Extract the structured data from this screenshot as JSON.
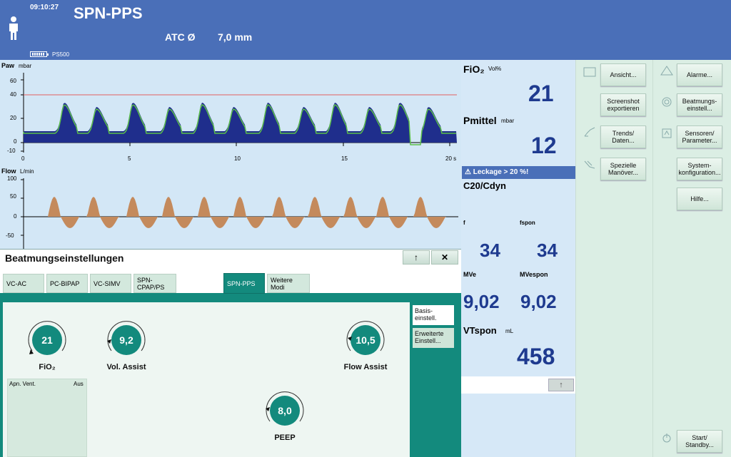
{
  "header": {
    "time": "09:10:27",
    "mode": "SPN-PPS",
    "atc_label": "ATC Ø",
    "atc_value": "7,0 mm",
    "device": "PS500",
    "bg_color": "#4a6fb8"
  },
  "waves": {
    "paw": {
      "title": "Paw",
      "unit": "mbar",
      "y_ticks": [
        "60",
        "40",
        "20",
        "0",
        "-10"
      ]
    },
    "flow": {
      "title": "Flow",
      "unit": "L/min",
      "y_ticks": [
        "100",
        "50",
        "0",
        "-50"
      ]
    },
    "x_ticks": [
      "0",
      "5",
      "10",
      "15",
      "20 s"
    ]
  },
  "measurements": {
    "fio2": {
      "label": "FiO₂",
      "unit": "Vol%",
      "value": "21"
    },
    "pmittel": {
      "label": "Pmittel",
      "unit": "mbar",
      "value": "12"
    },
    "leak_alert": "⚠ Leckage > 20 %!",
    "c20": {
      "label": "C20/Cdyn"
    },
    "f": {
      "label": "f",
      "value": "34"
    },
    "fspon": {
      "label": "fspon",
      "value": "34"
    },
    "mve": {
      "label": "MVe",
      "value": "9,02"
    },
    "mvespon": {
      "label": "MVespon",
      "value": "9,02"
    },
    "vtspon": {
      "label": "VTspon",
      "unit": "mL",
      "value": "458"
    },
    "up_arrow": "↑"
  },
  "right_panel": {
    "col1": [
      {
        "label": "Ansicht..."
      },
      {
        "label": "Screenshot exportieren"
      },
      {
        "label": "Trends/ Daten..."
      },
      {
        "label": "Spezielle Manöver..."
      }
    ],
    "col2": [
      {
        "label": "Alarme..."
      },
      {
        "label": "Beatmungs-einstell..."
      },
      {
        "label": "Sensoren/ Parameter..."
      },
      {
        "label": "System-konfiguration..."
      },
      {
        "label": "Hilfe..."
      },
      {
        "label": "Start/ Standby..."
      }
    ]
  },
  "dialog": {
    "title": "Beatmungseinstellungen",
    "pin_icon": "↑",
    "close_icon": "✕",
    "tabs": [
      {
        "label": "VC-AC"
      },
      {
        "label": "PC-BIPAP"
      },
      {
        "label": "VC-SIMV"
      },
      {
        "label": "SPN-CPAP/PS"
      },
      {
        "label": "SPN-PPS",
        "active": true
      },
      {
        "label": "Weitere Modi"
      }
    ],
    "side_tabs": [
      {
        "label": "Basis-einstell."
      },
      {
        "label": "Erweiterte Einstell..."
      }
    ],
    "knobs": {
      "fio2": {
        "value": "21",
        "label": "FiO₂"
      },
      "vol_assist": {
        "value": "9,2",
        "label": "Vol. Assist"
      },
      "flow_assist": {
        "value": "10,5",
        "label": "Flow Assist"
      },
      "peep": {
        "value": "8,0",
        "label": "PEEP"
      }
    },
    "apnea": {
      "label": "Apn. Vent.",
      "value": "Aus"
    },
    "accent_color": "#138a7d"
  }
}
